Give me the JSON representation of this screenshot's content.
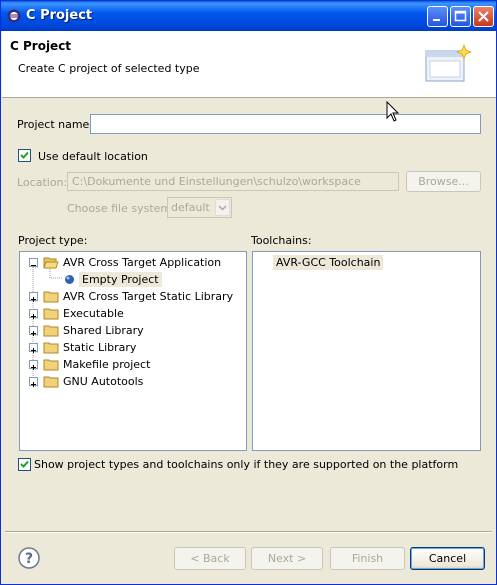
{
  "window": {
    "title": "C Project"
  },
  "banner": {
    "title": "C Project",
    "description": "Create C project of selected type"
  },
  "form": {
    "project_name_label": "Project name:",
    "project_name_value": "",
    "use_default_location_label": "Use default location",
    "use_default_location_checked": true,
    "location_label": "Location:",
    "location_value": "C:\\Dokumente und Einstellungen\\schulzo\\workspace",
    "browse_label": "Browse...",
    "file_system_label": "Choose file system:",
    "file_system_value": "default"
  },
  "project_type": {
    "label": "Project type:",
    "items": [
      {
        "label": "AVR Cross Target Application",
        "expanded": true
      },
      {
        "label": "Empty Project",
        "child": true,
        "selected": true
      },
      {
        "label": "AVR Cross Target Static Library"
      },
      {
        "label": "Executable"
      },
      {
        "label": "Shared Library"
      },
      {
        "label": "Static Library"
      },
      {
        "label": "Makefile project"
      },
      {
        "label": "GNU Autotools"
      }
    ]
  },
  "toolchains": {
    "label": "Toolchains:",
    "items": [
      "AVR-GCC Toolchain"
    ]
  },
  "show_supported_label": "Show project types and toolchains only if they are supported on the platform",
  "show_supported_checked": true,
  "buttons": {
    "back": "< Back",
    "next": "Next >",
    "finish": "Finish",
    "cancel": "Cancel"
  },
  "colors": {
    "titlebar": "#0058ee",
    "dialog_bg": "#ece9d8",
    "selection_bg": "#ece9d8"
  }
}
